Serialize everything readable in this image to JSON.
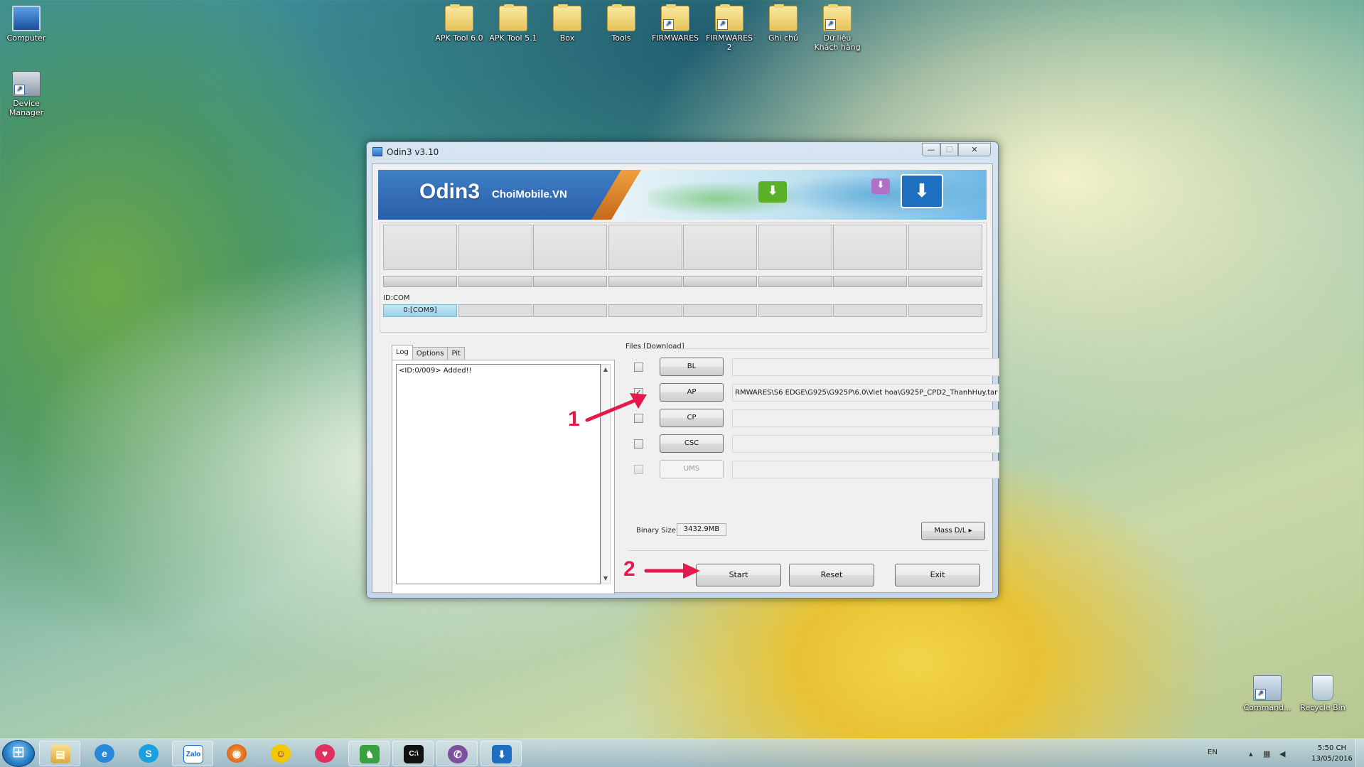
{
  "desktop": {
    "left_icons": [
      {
        "label": "Computer"
      },
      {
        "label": "Device\nManager"
      }
    ],
    "top_icons": [
      {
        "label": "APK Tool 6.0"
      },
      {
        "label": "APK Tool 5.1"
      },
      {
        "label": "Box"
      },
      {
        "label": "Tools"
      },
      {
        "label": "FIRMWARES"
      },
      {
        "label": "FIRMWARES 2"
      },
      {
        "label": "Ghi chú"
      },
      {
        "label": "Dữ liệu Khách hàng"
      }
    ],
    "bottom_right_icons": [
      {
        "label": "Command..."
      },
      {
        "label": "Recycle Bin"
      }
    ]
  },
  "window": {
    "title": "Odin3 v3.10",
    "controls": {
      "minimize": "—",
      "maximize": "☐",
      "close": "✕"
    },
    "banner": {
      "brand": "Odin3",
      "sub": "ChoiMobile.VN"
    },
    "id_com_label": "ID:COM",
    "com_ports": [
      "0:[COM9]",
      "",
      "",
      "",
      "",
      "",
      "",
      ""
    ],
    "tabs": [
      "Log",
      "Options",
      "Pit"
    ],
    "active_tab": "Log",
    "log_text": "<ID:0/009> Added!!",
    "files_label": "Files [Download]",
    "files": [
      {
        "button": "BL",
        "checked": false,
        "path": "",
        "enabled": true
      },
      {
        "button": "AP",
        "checked": true,
        "path": "RMWARES\\S6 EDGE\\G925\\G925P\\6.0\\Viet hoa\\G925P_CPD2_ThanhHuy.tar",
        "enabled": true
      },
      {
        "button": "CP",
        "checked": false,
        "path": "",
        "enabled": true
      },
      {
        "button": "CSC",
        "checked": false,
        "path": "",
        "enabled": true
      },
      {
        "button": "UMS",
        "checked": false,
        "path": "",
        "enabled": false
      }
    ],
    "binary_size_label": "Binary Size",
    "binary_size_value": "3432.9MB",
    "mass_dl_label": "Mass D/L ▸",
    "buttons": {
      "start": "Start",
      "reset": "Reset",
      "exit": "Exit"
    }
  },
  "annotations": {
    "one": "1",
    "two": "2",
    "color": "#e5194b"
  },
  "taskbar": {
    "items": [
      "explorer-icon",
      "internet-explorer-icon",
      "skype-icon",
      "zalo-icon",
      "firefox-icon",
      "yahoo-messenger-icon",
      "lips-app-icon",
      "game-app-icon",
      "command-prompt-icon",
      "viber-icon",
      "odin-icon"
    ],
    "zalo_text": "Zalo",
    "language": "EN",
    "time": "5:50 CH",
    "date": "13/05/2016"
  }
}
